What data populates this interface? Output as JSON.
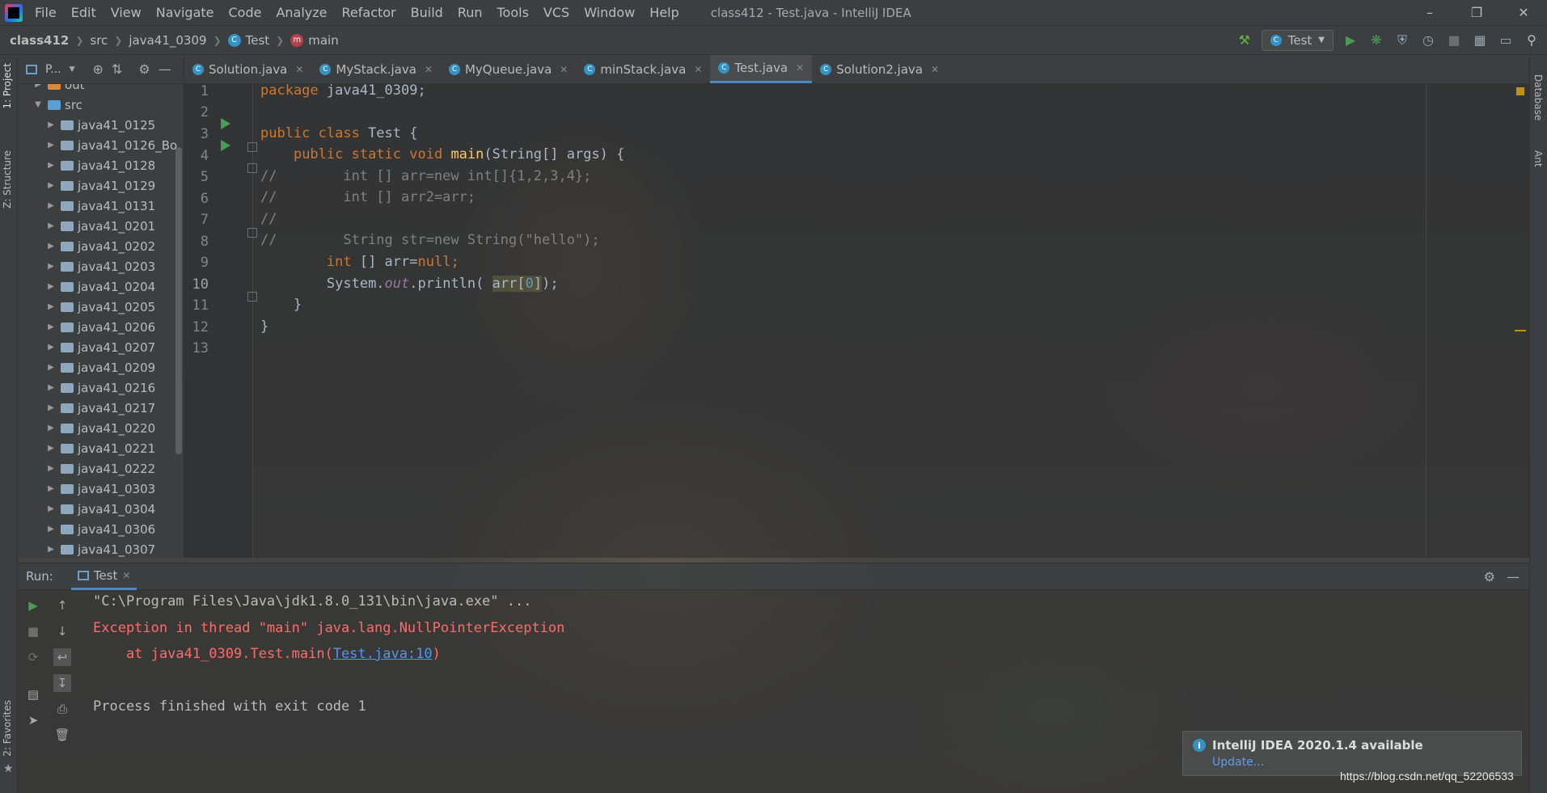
{
  "window": {
    "title": "class412 - Test.java - IntelliJ IDEA",
    "menu": [
      "File",
      "Edit",
      "View",
      "Navigate",
      "Code",
      "Analyze",
      "Refactor",
      "Build",
      "Run",
      "Tools",
      "VCS",
      "Window",
      "Help"
    ]
  },
  "breadcrumb": [
    "class412",
    "src",
    "java41_0309",
    "Test",
    "main"
  ],
  "toolbar": {
    "run_config": "Test"
  },
  "side_tabs": {
    "project": "1: Project",
    "structure": "Z: Structure",
    "favorites": "2: Favorites",
    "database": "Database",
    "ant": "Ant"
  },
  "project_panel": {
    "title": "P...",
    "tree": [
      {
        "label": "out",
        "type": "folder-orange",
        "depth": 0,
        "expanded": false
      },
      {
        "label": "src",
        "type": "folder-blue",
        "depth": 0,
        "expanded": true
      },
      {
        "label": "java41_0125",
        "type": "package",
        "depth": 1
      },
      {
        "label": "java41_0126_Bo",
        "type": "package",
        "depth": 1
      },
      {
        "label": "java41_0128",
        "type": "package",
        "depth": 1
      },
      {
        "label": "java41_0129",
        "type": "package",
        "depth": 1
      },
      {
        "label": "java41_0131",
        "type": "package",
        "depth": 1
      },
      {
        "label": "java41_0201",
        "type": "package",
        "depth": 1
      },
      {
        "label": "java41_0202",
        "type": "package",
        "depth": 1
      },
      {
        "label": "java41_0203",
        "type": "package",
        "depth": 1
      },
      {
        "label": "java41_0204",
        "type": "package",
        "depth": 1
      },
      {
        "label": "java41_0205",
        "type": "package",
        "depth": 1
      },
      {
        "label": "java41_0206",
        "type": "package",
        "depth": 1
      },
      {
        "label": "java41_0207",
        "type": "package",
        "depth": 1
      },
      {
        "label": "java41_0209",
        "type": "package",
        "depth": 1
      },
      {
        "label": "java41_0216",
        "type": "package",
        "depth": 1
      },
      {
        "label": "java41_0217",
        "type": "package",
        "depth": 1
      },
      {
        "label": "java41_0220",
        "type": "package",
        "depth": 1
      },
      {
        "label": "java41_0221",
        "type": "package",
        "depth": 1
      },
      {
        "label": "java41_0222",
        "type": "package",
        "depth": 1
      },
      {
        "label": "java41_0303",
        "type": "package",
        "depth": 1
      },
      {
        "label": "java41_0304",
        "type": "package",
        "depth": 1
      },
      {
        "label": "java41_0306",
        "type": "package",
        "depth": 1
      },
      {
        "label": "java41_0307",
        "type": "package",
        "depth": 1
      }
    ]
  },
  "editor_tabs": [
    {
      "label": "Solution.java",
      "active": false
    },
    {
      "label": "MyStack.java",
      "active": false
    },
    {
      "label": "MyQueue.java",
      "active": false
    },
    {
      "label": "minStack.java",
      "active": false
    },
    {
      "label": "Test.java",
      "active": true
    },
    {
      "label": "Solution2.java",
      "active": false
    }
  ],
  "editor": {
    "line_numbers": [
      "1",
      "2",
      "3",
      "4",
      "5",
      "6",
      "7",
      "8",
      "9",
      "10",
      "11",
      "12",
      "13"
    ],
    "lines": {
      "l1": {
        "kw": "package",
        "rest": " java41_0309;"
      },
      "l3": {
        "kw": "public class",
        "rest": " Test {"
      },
      "l4": {
        "kw": "public static void",
        "fn": "main",
        "rest": "(String[] args) {"
      },
      "l5": "//        int [] arr=new int[]{1,2,3,4};",
      "l6": "//        int [] arr2=arr;",
      "l7": "//",
      "l8": "//        String str=new String(\"hello\");",
      "l9": {
        "kw": "int",
        "rest": " [] arr=",
        "kw2": "null",
        "end": ";"
      },
      "l10": {
        "pre": "System.",
        "field": "out",
        "mid": ".println( ",
        "hl": "arr[",
        "num": "0",
        "hl2": "]",
        "end": ");"
      },
      "l11": "}",
      "l12": "}"
    }
  },
  "run_panel": {
    "label": "Run:",
    "tab": "Test",
    "console": {
      "cmd": "\"C:\\Program Files\\Java\\jdk1.8.0_131\\bin\\java.exe\" ...",
      "error": "Exception in thread \"main\" java.lang.NullPointerException",
      "at_prefix": "    at java41_0309.Test.main(",
      "at_link": "Test.java:10",
      "at_suffix": ")",
      "exit": "Process finished with exit code 1"
    }
  },
  "notification": {
    "title": "IntelliJ IDEA 2020.1.4 available",
    "link": "Update..."
  },
  "watermark": "https://blog.csdn.net/qq_52206533"
}
